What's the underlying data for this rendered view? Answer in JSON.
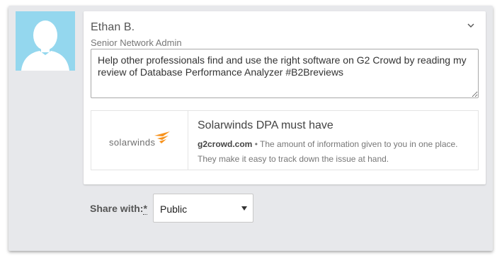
{
  "colors": {
    "panel_bg": "#e7e8eb",
    "avatar_bg": "#94d7ee",
    "logo_orange": "#f7931e"
  },
  "user": {
    "name": "Ethan B.",
    "title": "Senior Network Admin",
    "avatar_icon": "default-user-silhouette-icon"
  },
  "menu_icon": "chevron-down-icon",
  "message": {
    "text": "Help other professionals find and use the right software on G2 Crowd by reading my review of Database Performance Analyzer #B2Breviews"
  },
  "preview": {
    "logo_text": "solarwinds",
    "logo_icon": "solarwinds-bird-icon",
    "title": "Solarwinds DPA must have",
    "domain": "g2crowd.com",
    "separator": " • ",
    "description": "The amount of information given to you in one place. They make it easy to track down the issue at hand."
  },
  "share": {
    "label": "Share with:",
    "required_mark": "*",
    "selected": "Public",
    "arrow_icon": "dropdown-arrow-icon"
  }
}
